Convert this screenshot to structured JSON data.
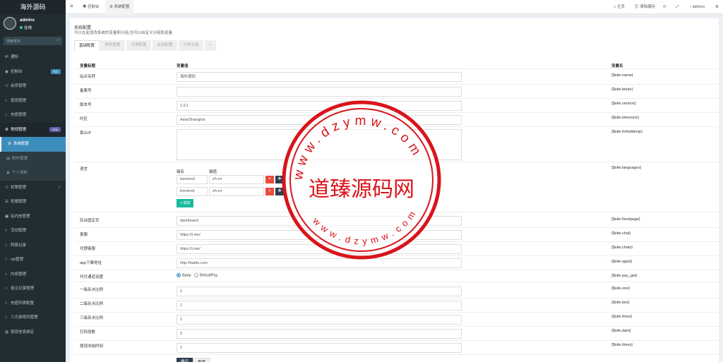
{
  "sidebar": {
    "logo": "海外源码",
    "user": {
      "name": "admins",
      "status": "在线"
    },
    "search_placeholder": "搜索菜单",
    "items": [
      {
        "icon": "bell-icon",
        "glyph": "✉",
        "label": "通知"
      },
      {
        "icon": "dashboard-icon",
        "glyph": "◉",
        "label": "控制台",
        "badge": "hot",
        "badge_color": "#3c8dbc"
      },
      {
        "icon": "users-icon",
        "glyph": "👥",
        "label": "会员管理"
      },
      {
        "icon": "circle-icon",
        "glyph": "○",
        "label": "提现管理"
      },
      {
        "icon": "circle-icon",
        "glyph": "○",
        "label": "充值管理"
      },
      {
        "icon": "gears-icon",
        "glyph": "⚙",
        "label": "常规管理",
        "badge": "new",
        "badge_color": "#605ca8"
      },
      {
        "icon": "gear-icon",
        "glyph": "⚙",
        "label": "系统配置"
      },
      {
        "icon": "file-icon",
        "glyph": "▤",
        "label": "附件管理"
      },
      {
        "icon": "user-icon",
        "glyph": "👤",
        "label": "个人资料"
      },
      {
        "icon": "group-icon",
        "glyph": "👥",
        "label": "权限管理"
      },
      {
        "icon": "menu-icon",
        "glyph": "☰",
        "label": "轮播管理"
      },
      {
        "icon": "calendar-icon",
        "glyph": "▦",
        "label": "站内信管理"
      },
      {
        "icon": "circle-icon",
        "glyph": "○",
        "label": "活动管理"
      },
      {
        "icon": "circle-icon",
        "glyph": "○",
        "label": "转换记录"
      },
      {
        "icon": "circle-icon",
        "glyph": "○",
        "label": "vip管理"
      },
      {
        "icon": "circle-icon",
        "glyph": "○",
        "label": "内容管理"
      },
      {
        "icon": "circle-icon",
        "glyph": "○",
        "label": "投注记录管理"
      },
      {
        "icon": "circle-icon",
        "glyph": "○",
        "label": "充值列表配置"
      },
      {
        "icon": "circle-icon",
        "glyph": "○",
        "label": "三方游戏列管理"
      },
      {
        "icon": "bank-icon",
        "glyph": "▥",
        "label": "提现信息绑定"
      }
    ]
  },
  "header": {
    "tabs": [
      {
        "label": "控制台"
      },
      {
        "label": "系统配置"
      }
    ],
    "right": {
      "home": "主页",
      "clear_cache": "清除缓存",
      "user": "admins"
    }
  },
  "panel": {
    "title": "系统配置",
    "description": "可以在此增改系统的变量和分组,也可以自定义分组和变量",
    "tabs": [
      {
        "label": "基础配置"
      },
      {
        "label": "邮件配置"
      },
      {
        "label": "字典配置"
      },
      {
        "label": "会员配置"
      },
      {
        "label": "分类分组"
      },
      {
        "label": "+"
      }
    ],
    "columns": {
      "title": "变量标题",
      "value": "变量值",
      "name": "变量名"
    },
    "rows": [
      {
        "label": "站点名称",
        "value": "海外源码",
        "name": "{$site.name}"
      },
      {
        "label": "备案号",
        "value": "",
        "name": "{$site.beian}"
      },
      {
        "label": "版本号",
        "value": "1.0.1",
        "name": "{$site.version}"
      },
      {
        "label": "时区",
        "value": "Asia/Shanghai",
        "name": "{$site.timezone}"
      },
      {
        "label": "禁止IP",
        "value": "",
        "name": "{$site.forbiddenip}"
      },
      {
        "label": "语言",
        "value": "",
        "name": "{$site.languages}"
      },
      {
        "label": "后台固定页",
        "value": "dashboard",
        "name": "{$site.fixedpage}"
      },
      {
        "label": "客服",
        "value": "https://t.me/",
        "name": "{$site.chat}"
      },
      {
        "label": "代理客服",
        "value": "https://t.me/",
        "name": "{$site.chats}"
      },
      {
        "label": "app下载地址",
        "value": "http://baidu.com",
        "name": "{$site.appd}"
      },
      {
        "label": "代付通道设置",
        "value": "",
        "name": "{$site.pay_get}"
      },
      {
        "label": "一级反水比例",
        "value": "1",
        "name": "{$site.one}"
      },
      {
        "label": "二级反水比例",
        "value": "1",
        "name": "{$site.two}"
      },
      {
        "label": "三级反水比例",
        "value": "1",
        "name": "{$site.three}"
      },
      {
        "label": "打码倍数",
        "value": "2",
        "name": "{$site.dam}"
      },
      {
        "label": "提现冻结时间",
        "value": "1",
        "name": "{$site.times}"
      }
    ],
    "languages": {
      "key_header": "键名",
      "value_header": "键值",
      "items": [
        {
          "key": "backend",
          "value": "zh-cn"
        },
        {
          "key": "frontend",
          "value": "zh-cn"
        }
      ],
      "add_label": "+ 追加"
    },
    "pay_options": [
      "Bpay",
      "BetcatPay"
    ],
    "pay_selected": "Bpay",
    "submit_label": "确定",
    "reset_label": "重置"
  },
  "watermark": {
    "text": "道臻源码网",
    "url": "www.dzymw.com",
    "color": "#d9141b"
  }
}
